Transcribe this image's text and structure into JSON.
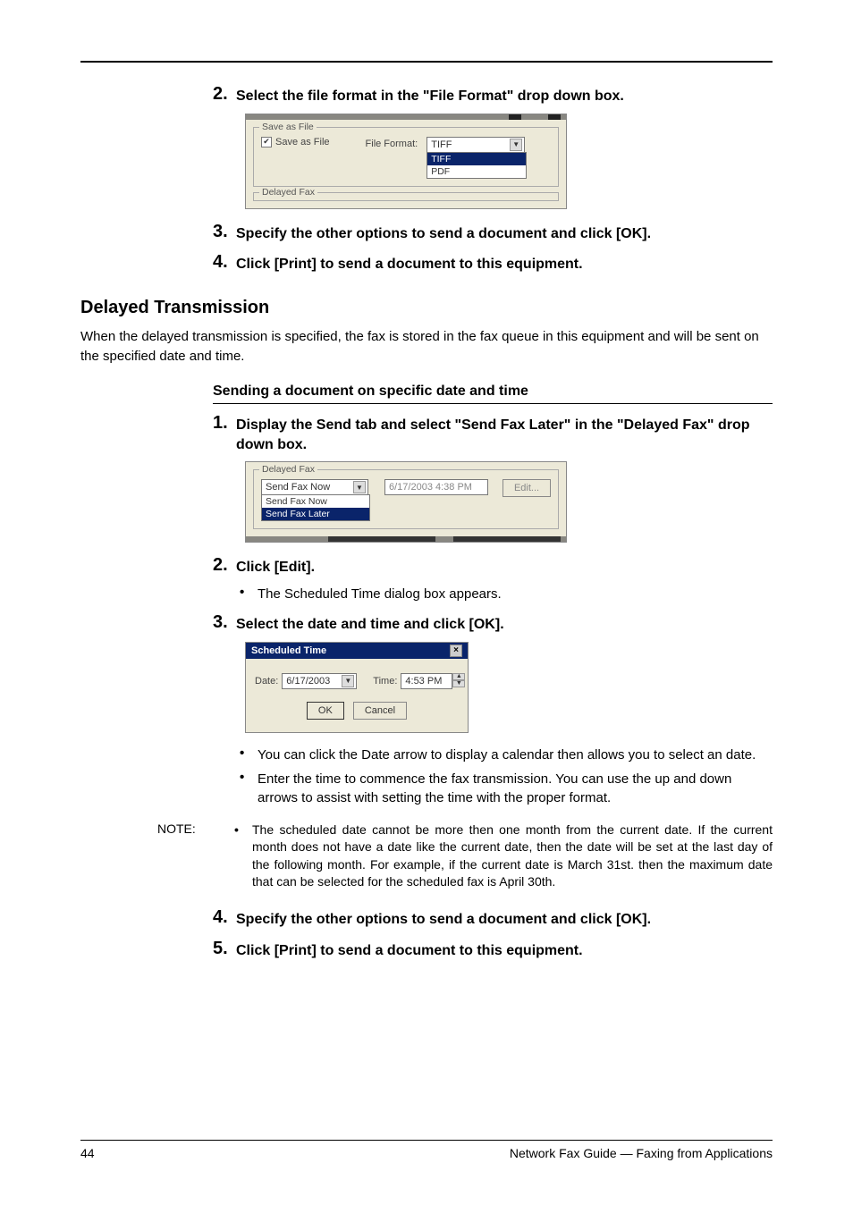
{
  "steps_top": {
    "s2": "Select the file format in the \"File Format\" drop down box.",
    "s3": "Specify the other options to send a document and click [OK].",
    "s4": "Click [Print] to send a document to this equipment."
  },
  "saveas_box": {
    "legend1": "Save as File",
    "chk_label": "Save as File",
    "ff_label": "File Format:",
    "selected": "TIFF",
    "opt_sel": "TIFF",
    "opt2": "PDF",
    "legend2": "Delayed Fax"
  },
  "section_title": "Delayed Transmission",
  "section_body": "When the delayed transmission is specified, the fax is stored in the fax queue in this equipment and will be sent on the specified date and time.",
  "subsection": "Sending a document on specific date and time",
  "steps_mid": {
    "s1": "Display the Send tab and select \"Send Fax Later\" in the \"Delayed Fax\" drop down box.",
    "s2": "Click [Edit].",
    "s2_bullet": "The Scheduled Time dialog box appears.",
    "s3": "Select the date and time and click [OK].",
    "s3_bullet1": "You can click the Date arrow to display a calendar then allows you to select an date.",
    "s3_bullet2": "Enter the time to commence the fax transmission. You can use the up and down arrows to assist with setting the time with the proper format.",
    "s4": "Specify the other options to send a document and click [OK].",
    "s5": "Click [Print] to send a document to this equipment."
  },
  "delayed_box": {
    "legend": "Delayed Fax",
    "combo_val": "Send Fax Now",
    "opt_sel": "Send Fax Now",
    "opt2": "Send Fax Later",
    "datetime": "6/17/2003 4:38 PM",
    "edit_btn": "Edit..."
  },
  "sched_dialog": {
    "title": "Scheduled Time",
    "date_label": "Date:",
    "date_val": "6/17/2003",
    "time_label": "Time:",
    "time_val": "4:53 PM",
    "ok": "OK",
    "cancel": "Cancel"
  },
  "note": {
    "label": "NOTE:",
    "text": "The scheduled date cannot be more then one month from the current date.  If the current month does not have a date like the current date, then the date will be set at the last day of the following month. For example, if the current date is March 31st. then the maximum date that can be selected for the scheduled fax is April 30th."
  },
  "footer": {
    "page": "44",
    "title": "Network Fax Guide — Faxing from Applications"
  }
}
